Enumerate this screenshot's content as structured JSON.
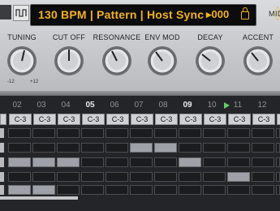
{
  "display": {
    "text": "130 BPM | Pattern | Host Sync",
    "counter": "▸000",
    "up_down": "△\n▽"
  },
  "side_label": "MID",
  "knobs": [
    {
      "label": "TUNING",
      "min": "-12",
      "max": "+12"
    },
    {
      "label": "CUT OFF"
    },
    {
      "label": "RESONANCE"
    },
    {
      "label": "ENV MOD"
    },
    {
      "label": "DECAY"
    },
    {
      "label": "ACCENT"
    }
  ],
  "sequencer": {
    "step_numbers": [
      "02",
      "03",
      "04",
      "05",
      "06",
      "07",
      "08",
      "09",
      "10",
      "11",
      "12"
    ],
    "highlighted_steps": [
      "05",
      "09"
    ],
    "playing_step": "11",
    "notes": [
      "C-3",
      "C-3",
      "C-3",
      "C-3",
      "C-3",
      "C-3",
      "C-3",
      "C-3",
      "C-3",
      "C-3",
      "C-3",
      "C-3"
    ],
    "colors": {
      "lcd_text": "#f2b21c",
      "play": "#5fd35f",
      "active_cell": "#9ea2a8"
    }
  }
}
